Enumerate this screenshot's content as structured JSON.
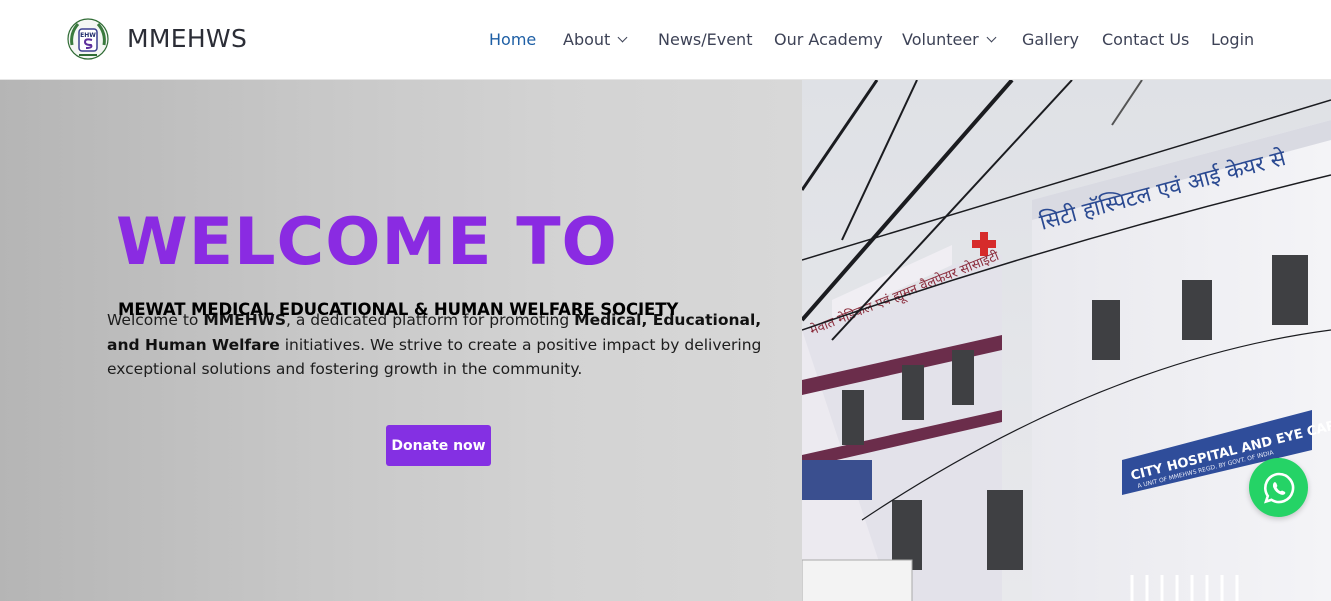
{
  "header": {
    "brand": "MMEHWS",
    "logo_icon": "ehw-emblem-icon",
    "nav": [
      {
        "label": "Home",
        "active": true,
        "has_dropdown": false
      },
      {
        "label": "About",
        "active": false,
        "has_dropdown": true
      },
      {
        "label": "News/Event",
        "active": false,
        "has_dropdown": false
      },
      {
        "label": "Our Academy",
        "active": false,
        "has_dropdown": false
      },
      {
        "label": "Volunteer",
        "active": false,
        "has_dropdown": true
      },
      {
        "label": "Gallery",
        "active": false,
        "has_dropdown": false
      },
      {
        "label": "Contact Us",
        "active": false,
        "has_dropdown": false
      },
      {
        "label": "Login",
        "active": false,
        "has_dropdown": false
      }
    ]
  },
  "hero": {
    "heading": "WELCOME TO",
    "subheading": "MEWAT MEDICAL EDUCATIONAL & HUMAN WELFARE SOCIETY",
    "intro": {
      "t1": "Welcome to ",
      "b1": "MMEHWS",
      "t2": ", a dedicated platform for promoting ",
      "b2": "Medical, Educational, and Human Welfare",
      "t3": " initiatives. We strive to create a positive impact by delivering exceptional solutions and fostering growth in the community."
    },
    "donate_label": "Donate now",
    "photo": {
      "sign_top": "सिटी हॉस्पिटल एवं आई केयर से",
      "sign_side": "मेवात मेडिकल एवं ह्यूमन वैलफेयर सोसाइटी",
      "sign_board": "CITY HOSPITAL AND EYE CARE CENTRE",
      "sign_board_sub": "A UNIT OF MMEHWS REGD. BY GOVT. OF INDIA"
    }
  },
  "colors": {
    "accent": "#8a2be2",
    "button": "#8430e3",
    "nav_active": "#1e5fa5",
    "whatsapp": "#25d366"
  },
  "floating": {
    "whatsapp_icon": "whatsapp-icon"
  }
}
